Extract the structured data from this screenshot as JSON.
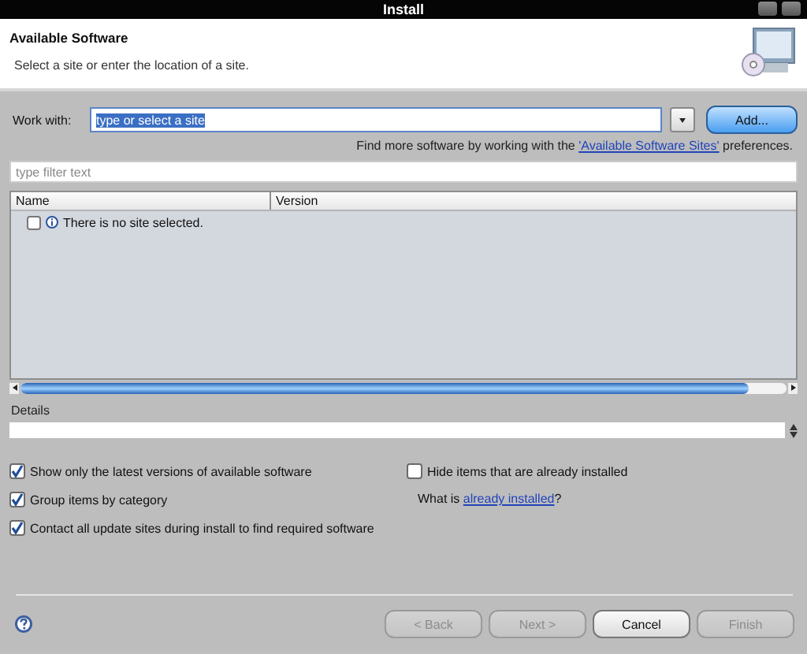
{
  "window": {
    "title": "Install"
  },
  "header": {
    "title": "Available Software",
    "description": "Select a site or enter the location of a site."
  },
  "work_with": {
    "label": "Work with:",
    "value": "type or select a site",
    "value_highlighted": true,
    "add_button": "Add..."
  },
  "more_software": {
    "text": "Find more software by working with the",
    "link": "'Available Software Sites'",
    "suffix": "preferences."
  },
  "filter": {
    "placeholder": "type filter text"
  },
  "table": {
    "columns": [
      "Name",
      "Version"
    ],
    "rows": [
      {
        "checked": false,
        "name": "There is no site selected."
      }
    ]
  },
  "details": {
    "label": "Details"
  },
  "options": [
    {
      "label": "Show only the latest versions of available software",
      "checked": true
    },
    {
      "label": "Group items by category",
      "checked": true
    },
    {
      "label": "Contact all update sites during install to find required software",
      "checked": true
    }
  ],
  "side_options": [
    {
      "label": "Hide items that are already installed",
      "checked": false
    }
  ],
  "installed_note": {
    "text": "What is",
    "link": "already installed",
    "suffix": "?"
  },
  "buttons": [
    {
      "label": "< Back",
      "disabled": true
    },
    {
      "label": "Next >",
      "disabled": true
    },
    {
      "label": "Cancel",
      "disabled": false
    },
    {
      "label": "Finish",
      "disabled": true
    }
  ]
}
